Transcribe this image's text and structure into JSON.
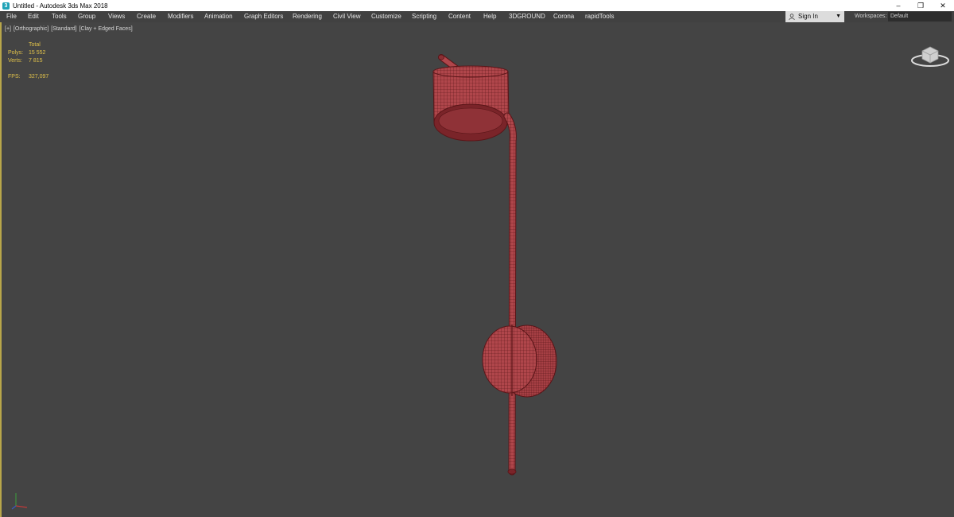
{
  "window": {
    "title": "Untitled - Autodesk 3ds Max 2018",
    "controls": {
      "minimize": "–",
      "restore": "❐",
      "close": "✕"
    }
  },
  "menu": {
    "items": [
      "File",
      "Edit",
      "Tools",
      "Group",
      "Views",
      "Create",
      "Modifiers",
      "Animation",
      "Graph Editors",
      "Rendering",
      "Civil View",
      "Customize",
      "Scripting",
      "Content",
      "Help",
      "3DGROUND",
      "Corona",
      "rapidTools"
    ]
  },
  "account": {
    "sign_in": "Sign In"
  },
  "workspaces": {
    "label": "Workspaces:",
    "value": "Default"
  },
  "viewport": {
    "labels": [
      "[+]",
      "[Orthographic]",
      "[Standard]",
      "[Clay + Edged Faces]"
    ],
    "stats": {
      "header": "Total",
      "polys_label": "Polys:",
      "polys_value": "15 552",
      "verts_label": "Verts:",
      "verts_value": "7 815",
      "fps_label": "FPS:",
      "fps_value": "327,097"
    }
  },
  "colors": {
    "viewport_bg": "#444444",
    "stats_text": "#e1c24a",
    "model_fill": "#b0464b",
    "model_wire": "#5a1518",
    "active_border": "#b8a64a"
  },
  "icons": {
    "app": "3ds-max-icon",
    "user": "user-icon",
    "navcube": "viewcube-icon",
    "axis": "axis-tripod-icon"
  }
}
